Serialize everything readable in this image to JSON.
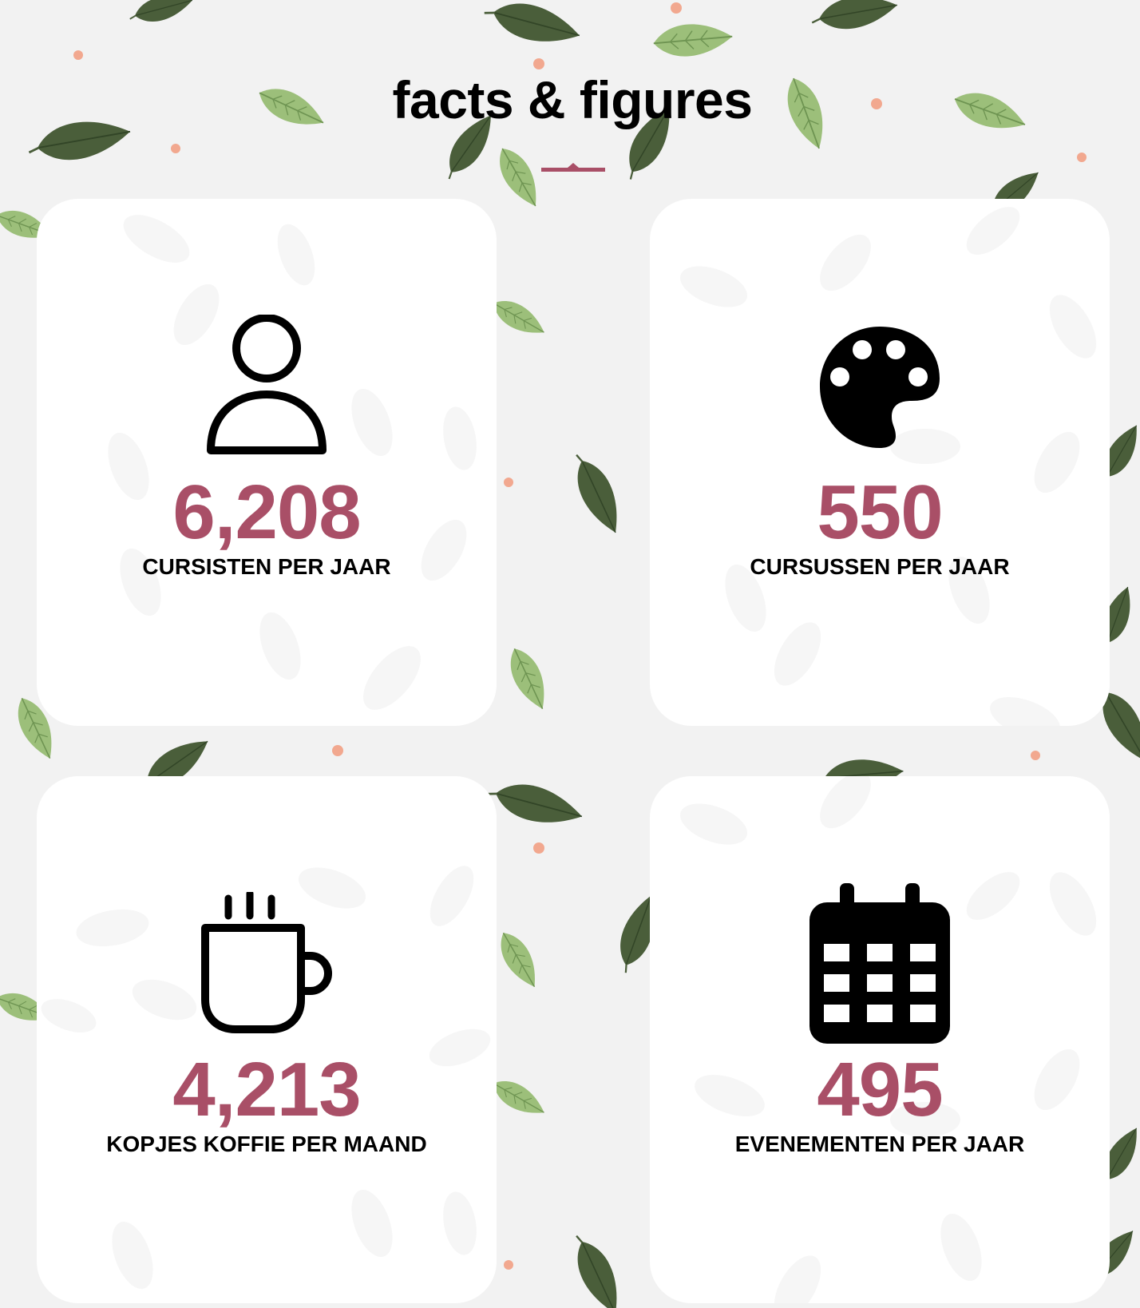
{
  "section": {
    "title": "facts & figures"
  },
  "stats": [
    {
      "icon": "user-icon",
      "number": "6,208",
      "label": "CURSISTEN PER JAAR"
    },
    {
      "icon": "palette-icon",
      "number": "550",
      "label": "CURSUSSEN PER JAAR"
    },
    {
      "icon": "coffee-mug-icon",
      "number": "4,213",
      "label": "KOPJES KOFFIE PER MAAND"
    },
    {
      "icon": "calendar-icon",
      "number": "495",
      "label": "EVENEMENTEN PER JAAR"
    }
  ],
  "colors": {
    "accent": "#a94f67",
    "page_background": "#f2f2f2",
    "card_background": "#ffffff",
    "leaf_dark": "#4a5e3a",
    "leaf_light": "#9cbf7a",
    "dot": "#f2a88f"
  }
}
